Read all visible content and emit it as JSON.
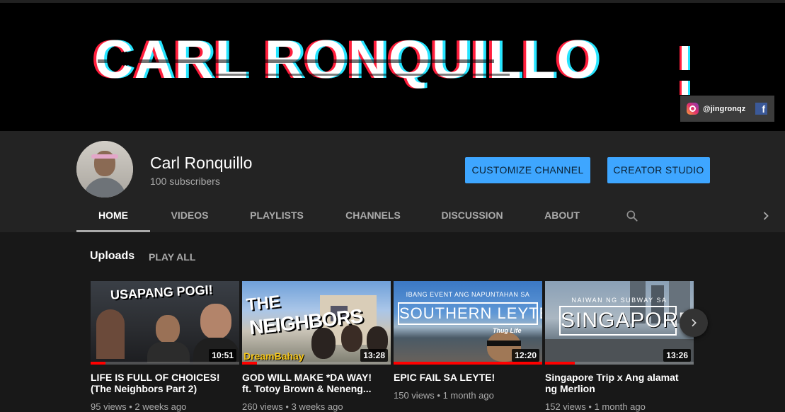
{
  "banner": {
    "title": "CARL RONQUILLO",
    "social_handle": "@jingronqz",
    "facebook_glyph": "f"
  },
  "channel": {
    "name": "Carl Ronquillo",
    "subscribers": "100 subscribers"
  },
  "buttons": {
    "customize": "CUSTOMIZE CHANNEL",
    "studio": "CREATOR STUDIO"
  },
  "tabs": [
    "HOME",
    "VIDEOS",
    "PLAYLISTS",
    "CHANNELS",
    "DISCUSSION",
    "ABOUT"
  ],
  "active_tab": "HOME",
  "section": {
    "title": "Uploads",
    "play_all": "PLAY ALL"
  },
  "videos": [
    {
      "title_line1": "LIFE IS FULL OF CHOICES!",
      "title_line2": "(The Neighbors Part 2)",
      "duration": "10:51",
      "views": "95 views",
      "age": "2 weeks ago",
      "thumb_text": "USAPANG POGI!",
      "watched_fraction": 0.1
    },
    {
      "title_line1": "GOD WILL MAKE *DA WAY!",
      "title_line2": "ft. Totoy Brown & Neneng...",
      "duration": "13:28",
      "views": "260 views",
      "age": "3 weeks ago",
      "thumb_text_a": "THE",
      "thumb_text_b": "NEIGHBORS",
      "thumb_text_c": "DreamBahay",
      "watched_fraction": 0.1
    },
    {
      "title_line1": "EPIC FAIL SA LEYTE!",
      "title_line2": "",
      "duration": "12:20",
      "views": "150 views",
      "age": "1 month ago",
      "thumb_text_a": "IBANG EVENT ANG NAPUNTAHAN SA",
      "thumb_text_b": "SOUTHERN LEYTE",
      "thumb_text_c": "Thug Life",
      "watched_fraction": 1.0
    },
    {
      "title_line1": "Singapore Trip x Ang alamat",
      "title_line2": "ng Merlion",
      "duration": "13:26",
      "views": "152 views",
      "age": "1 month ago",
      "thumb_text_a": "NAIWAN NG SUBWAY SA",
      "thumb_text_b": "SINGAPORE",
      "watched_fraction": 0.2
    }
  ],
  "colors": {
    "accent_button": "#3ea6ff",
    "background": "#181818",
    "header": "#232323",
    "progress": "#ff0000"
  }
}
